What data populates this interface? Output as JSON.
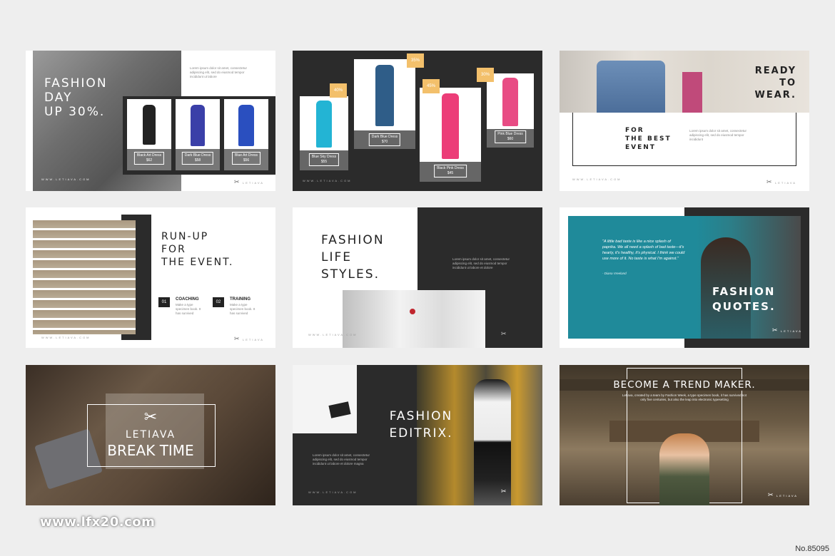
{
  "slide1": {
    "title_lines": [
      "FASHION",
      "DAY",
      "UP 30%."
    ],
    "lorem": "Lorem ipsum dolor sit amet, consectetur adipiscing elit, sed do eiusmod tempor incididunt ut labore",
    "products": [
      {
        "name": "Black Art Dress",
        "price": "$62"
      },
      {
        "name": "Dark Blue Dress",
        "price": "$58"
      },
      {
        "name": "Blue Art Dress",
        "price": "$56"
      }
    ],
    "footer": "WWW.LETIAVA.COM",
    "logo": "LETIAVA"
  },
  "slide2": {
    "products": [
      {
        "name": "Blue Sky Dress",
        "price": "$55",
        "badge": "40%",
        "color": "#23b4d4"
      },
      {
        "name": "Dark Blue Dress",
        "price": "$70",
        "badge": "35%",
        "color": "#2f5d88"
      },
      {
        "name": "Black Pink Dress",
        "price": "$45",
        "badge": "45%",
        "color": "#ec3d78"
      },
      {
        "name": "Pink Blue Dress",
        "price": "$60",
        "badge": "30%",
        "color": "#e84c84"
      }
    ],
    "footer": "WWW.LETIAVA.COM"
  },
  "slide3": {
    "title_lines": [
      "READY",
      "TO",
      "WEAR."
    ],
    "subtitle_lines": [
      "FOR",
      "THE BEST",
      "EVENT"
    ],
    "lorem": "Lorem ipsum dolor sit amet, consectetur adipiscing elit, sed do eiusmod tempor incididunt",
    "footer": "WWW.LETIAVA.COM",
    "logo": "LETIAVA"
  },
  "slide4": {
    "title_lines": [
      "RUN-UP",
      "FOR",
      "THE EVENT."
    ],
    "items": [
      {
        "num": "01",
        "label": "COACHING",
        "text": "Make a type specimen book. It has survived"
      },
      {
        "num": "02",
        "label": "TRAINING",
        "text": "Make a type specimen book. It has survived"
      }
    ],
    "footer": "WWW.LETIAVA.COM",
    "logo": "LETIAVA"
  },
  "slide5": {
    "title_lines": [
      "FASHION",
      "LIFE",
      "STYLES."
    ],
    "lorem": "Lorem ipsum dolor sit amet, consectetur adipiscing elit, sed do eiusmod tempor incididunt ut labore et dolore",
    "footer": "WWW.LETIAVA.COM"
  },
  "slide6": {
    "quote": "\"A little bad taste is like a nice splash of paprika. We all need a splash of bad taste—it's hearty, it's healthy, it's physical. I think we could use more of it. No taste is what I'm against.\"",
    "author": "- Diana Vreeland",
    "title_lines": [
      "FASHION",
      "QUOTES."
    ],
    "logo": "LETIAVA"
  },
  "slide7": {
    "brand": "LETIAVA",
    "title": "BREAK TIME"
  },
  "slide8": {
    "title_lines": [
      "FASHION",
      "EDITRIX."
    ],
    "lorem": "Lorem ipsum dolor sit amet, consectetur adipiscing elit, sed do eiusmod tempor incididunt ut labore et dolore magna",
    "footer": "WWW.LETIAVA.COM"
  },
  "slide9": {
    "title": "BECOME A TREND MAKER.",
    "lorem": "Letiava, created by a team by Fashion Week, a type specimen book, it has survived not only five centuries, but also the leap into electronic typesetting",
    "logo": "LETIAVA"
  },
  "watermark": "www.lfx20.com",
  "ref_number": "No.85095",
  "colors": {
    "dark": "#2b2b2b",
    "badge": "#f3c06b",
    "teal": "#1f8a9a",
    "background": "#eeeeee"
  }
}
